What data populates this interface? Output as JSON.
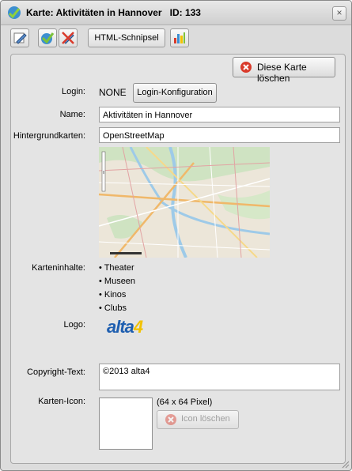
{
  "window": {
    "title": "Karte: Aktivitäten in Hannover",
    "id_label": "ID:",
    "id_value": "133",
    "close_symbol": "×"
  },
  "toolbar": {
    "html_snippet_label": "HTML-Schnipsel",
    "edit_icon": "pencil-icon",
    "check_icon": "check-icon",
    "cancel_icon": "cancel-pencil-icon",
    "chart_icon": "bar-chart-icon"
  },
  "panel": {
    "delete_map_label": "Diese Karte löschen",
    "login": {
      "label": "Login:",
      "value": "NONE",
      "button_label": "Login-Konfiguration"
    },
    "name": {
      "label": "Name:",
      "value": "Aktivitäten in Hannover"
    },
    "basemaps": {
      "label": "Hintergrundkarten:",
      "value": "OpenStreetMap"
    },
    "contents": {
      "label": "Karteninhalte:",
      "items": [
        "• Theater",
        "• Museen",
        "• Kinos",
        "• Clubs"
      ]
    },
    "logo": {
      "label": "Logo:",
      "text_main": "alta",
      "text_accent": "4"
    },
    "copyright": {
      "label": "Copyright-Text:",
      "value": "©2013 alta4"
    },
    "map_icon": {
      "label": "Karten-Icon:",
      "size_note": "(64 x 64 Pixel)",
      "delete_label": "Icon löschen"
    }
  },
  "colors": {
    "delete_red": "#d93a2b",
    "logo_blue": "#1f5fb0",
    "logo_yellow": "#f2c200"
  }
}
